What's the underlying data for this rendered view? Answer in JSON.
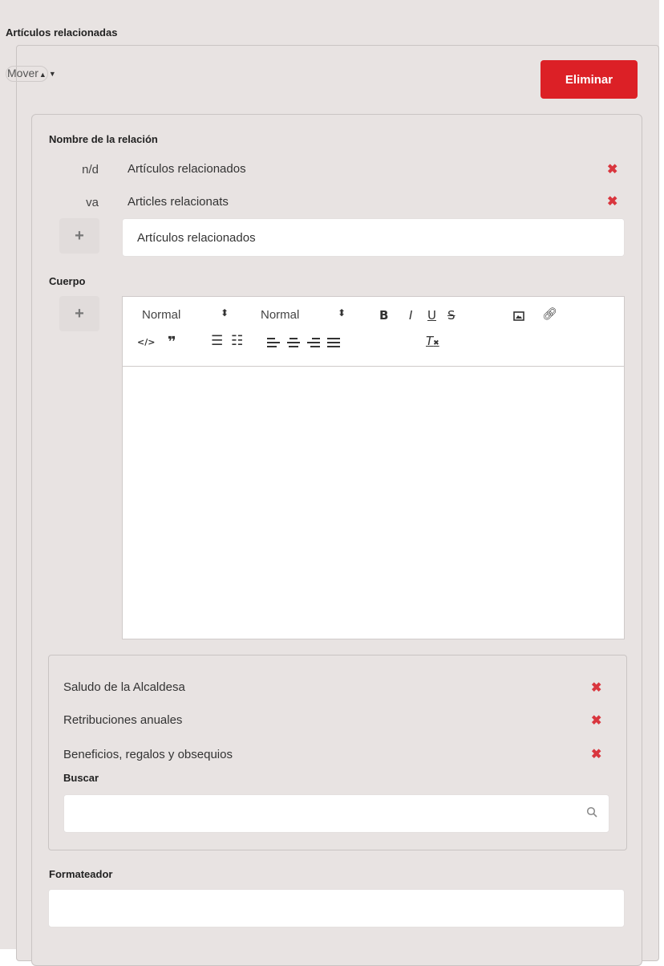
{
  "section": {
    "title": "Artículos relacionadas"
  },
  "mover": {
    "label": "Mover",
    "up_icon": "caret-up-icon",
    "down_icon": "caret-down-icon"
  },
  "delete_button": {
    "label": "Eliminar",
    "color": "#dc2026"
  },
  "relation_name": {
    "label": "Nombre de la relación",
    "translations": [
      {
        "code": "n/d",
        "value": "Artículos relacionados"
      },
      {
        "code": "va",
        "value": "Articles relacionats"
      }
    ],
    "add_icon": "plus-icon",
    "input_value": "Artículos relacionados"
  },
  "body": {
    "label": "Cuerpo",
    "add_icon": "plus-icon",
    "toolbar": {
      "font_select": "Normal",
      "size_select": "Normal",
      "bold": "B",
      "italic": "I",
      "underline": "U",
      "strike": "S",
      "clean": "T"
    },
    "content": ""
  },
  "related_items": [
    {
      "label": "Saludo de la Alcaldesa"
    },
    {
      "label": "Retribuciones anuales"
    },
    {
      "label": "Beneficios, regalos y obsequios"
    }
  ],
  "search": {
    "label": "Buscar",
    "value": "",
    "icon": "search-icon"
  },
  "formatter": {
    "label": "Formateador",
    "value": ""
  },
  "colors": {
    "remove_icon": "#d9363e",
    "background": "#e8e3e2"
  }
}
